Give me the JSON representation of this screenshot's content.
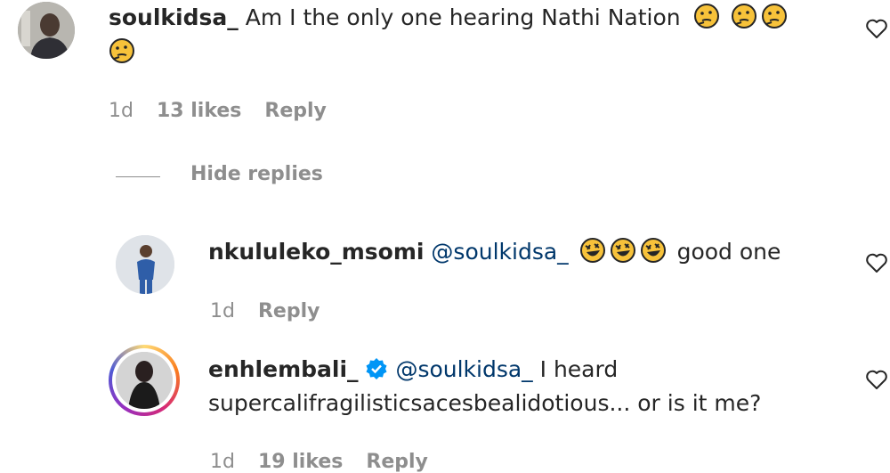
{
  "comments": [
    {
      "username": "soulkidsa_",
      "text": "Am I the only one hearing Nathi Nation",
      "emojis": [
        "thinking-face",
        "thinking-face",
        "thinking-face",
        "thinking-face"
      ],
      "time": "1d",
      "likes": "13 likes",
      "reply_label": "Reply"
    }
  ],
  "hide_replies_label": "Hide replies",
  "replies": [
    {
      "username": "nkululeko_msomi",
      "mention": "@soulkidsa_",
      "emojis": [
        "rolling-on-floor-laughing",
        "rolling-on-floor-laughing",
        "rolling-on-floor-laughing"
      ],
      "text": "good one",
      "time": "1d",
      "reply_label": "Reply"
    },
    {
      "username": "enhlembali_",
      "verified": true,
      "mention": "@soulkidsa_",
      "text_line1": "I heard",
      "text_line2": "supercalifragilisticsacesbealidotious... or is it me?",
      "time": "1d",
      "likes": "19 likes",
      "reply_label": "Reply"
    }
  ],
  "colors": {
    "text": "#262626",
    "meta": "#8e8e8e",
    "mention": "#00376b",
    "verified": "#0095f6",
    "emoji": "#f7c23a",
    "story_ring": "#d6249f"
  }
}
